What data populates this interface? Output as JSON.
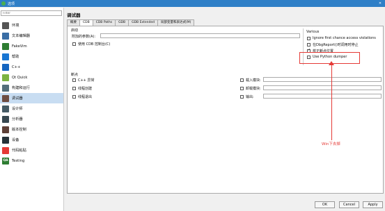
{
  "window": {
    "title": "选项"
  },
  "sidebar": {
    "filter_placeholder": "Filter",
    "categories": [
      {
        "label": "环境",
        "icon": "monitor-icon",
        "color": "#555555",
        "selected": false
      },
      {
        "label": "文本编辑器",
        "icon": "text-editor-icon",
        "color": "#3a6ea5",
        "selected": false
      },
      {
        "label": "FakeVim",
        "icon": "fakevim-icon",
        "color": "#2e7d32",
        "selected": false
      },
      {
        "label": "帮助",
        "icon": "help-icon",
        "color": "#1976d2",
        "selected": false
      },
      {
        "label": "C++",
        "icon": "cpp-icon",
        "color": "#1565c0",
        "selected": false
      },
      {
        "label": "Qt Quick",
        "icon": "qt-quick-icon",
        "color": "#7cb342",
        "selected": false
      },
      {
        "label": "构建和运行",
        "icon": "build-run-icon",
        "color": "#546e7a",
        "selected": false
      },
      {
        "label": "调试器",
        "icon": "debugger-icon",
        "color": "#6d4c41",
        "selected": true
      },
      {
        "label": "设计师",
        "icon": "designer-icon",
        "color": "#455a64",
        "selected": false
      },
      {
        "label": "分析器",
        "icon": "analyzer-icon",
        "color": "#37474f",
        "selected": false
      },
      {
        "label": "版本控制",
        "icon": "version-control-icon",
        "color": "#5d4037",
        "selected": false
      },
      {
        "label": "设备",
        "icon": "devices-icon",
        "color": "#263238",
        "selected": false
      },
      {
        "label": "代码粘贴",
        "icon": "code-paste-icon",
        "color": "#e53935",
        "selected": false
      },
      {
        "label": "Testing",
        "icon": "testing-icon",
        "color": "#2e7d32",
        "icon_text": "QA",
        "selected": false
      }
    ]
  },
  "page": {
    "title": "调试器",
    "tabs": [
      "概要",
      "CDB",
      "CDB Paths",
      "GDB",
      "GDB Extended",
      "局部变量和表达式(M)"
    ],
    "active_tab": 1
  },
  "launch": {
    "title": "启动",
    "extra_args_label": "附加的参数(A):",
    "extra_args_value": "",
    "use_console": "使用 CDB 控制台(C)"
  },
  "various": {
    "title": "Various",
    "items": [
      {
        "label": "Ignore first chance access violations",
        "checked": false
      },
      {
        "label": "在DbgReport()时调用时停止",
        "checked": false
      },
      {
        "label": "校正断点位置",
        "checked": true
      },
      {
        "label": "Use Python dumper",
        "checked": false
      }
    ]
  },
  "breakpoints": {
    "title": "断点",
    "left": [
      {
        "label": "C++ 异常",
        "checked": false
      },
      {
        "label": "线程创建",
        "checked": false
      },
      {
        "label": "线程退出",
        "checked": false
      }
    ],
    "right": [
      {
        "label": "载入模块:",
        "checked": false
      },
      {
        "label": "卸载模块:",
        "checked": false
      },
      {
        "label": "输出:",
        "checked": false
      }
    ]
  },
  "annotation": {
    "text": "Win下去掉",
    "color": "#e53935"
  },
  "buttons": {
    "ok": "OK",
    "cancel": "Cancel",
    "apply": "Apply"
  }
}
